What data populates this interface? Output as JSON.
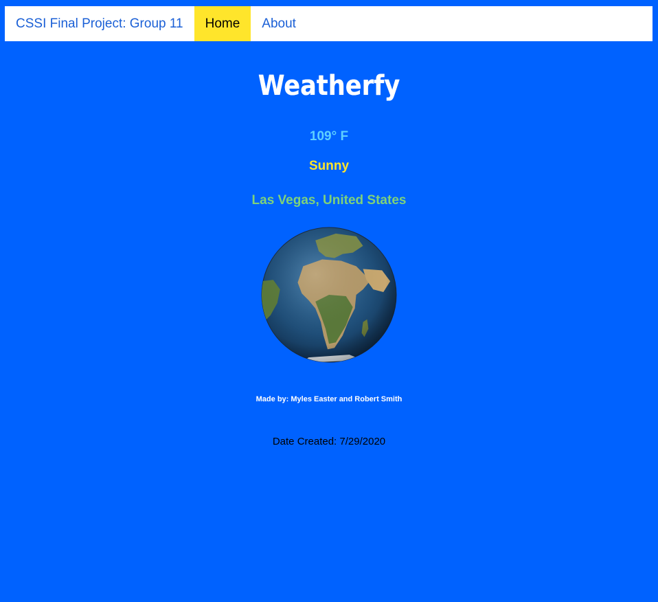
{
  "nav": {
    "brand": "CSSI Final Project: Group 11",
    "items": [
      {
        "label": "Home",
        "active": true
      },
      {
        "label": "About",
        "active": false
      }
    ]
  },
  "main": {
    "title": "Weatherfy",
    "temperature": "109° F",
    "condition": "Sunny",
    "location": "Las Vegas, United States",
    "globe_icon": "earth-globe-icon",
    "credits": "Made by: Myles Easter and Robert Smith",
    "date_created": "Date Created: 7/29/2020"
  },
  "colors": {
    "background": "#0062ff",
    "nav_active": "#ffe52b",
    "temperature": "#5fd0ff",
    "condition": "#ffe52b",
    "location": "#7ed27a"
  }
}
